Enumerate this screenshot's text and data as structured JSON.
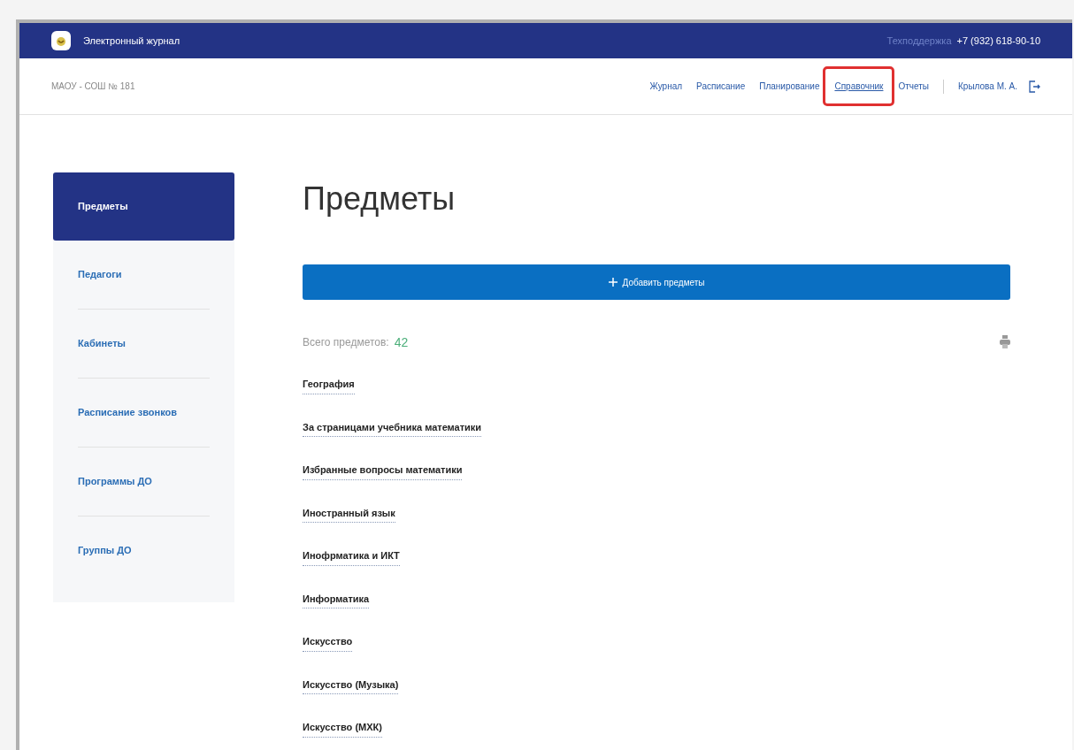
{
  "header": {
    "app_title": "Электронный журнал",
    "support_label": "Техподдержка",
    "support_phone": "+7 (932) 618-90-10"
  },
  "navbar": {
    "school": "МАОУ - СОШ № 181",
    "items": [
      {
        "label": "Журнал",
        "selected": false,
        "highlighted": false
      },
      {
        "label": "Расписание",
        "selected": false,
        "highlighted": false
      },
      {
        "label": "Планирование",
        "selected": false,
        "highlighted": false
      },
      {
        "label": "Справочник",
        "selected": true,
        "highlighted": true
      },
      {
        "label": "Отчеты",
        "selected": false,
        "highlighted": false
      }
    ],
    "user": "Крылова М. А."
  },
  "sidebar": {
    "items": [
      {
        "label": "Предметы",
        "selected": true
      },
      {
        "label": "Педагоги",
        "selected": false
      },
      {
        "label": "Кабинеты",
        "selected": false
      },
      {
        "label": "Расписание звонков",
        "selected": false
      },
      {
        "label": "Программы ДО",
        "selected": false
      },
      {
        "label": "Группы ДО",
        "selected": false
      }
    ]
  },
  "page": {
    "title": "Предметы",
    "add_button": "Добавить предметы",
    "total_label": "Всего предметов:",
    "total_value": "42",
    "subjects": [
      "География",
      "За страницами учебника математики",
      "Избранные вопросы математики",
      "Иностранный язык",
      "Инофрматика и ИКТ",
      "Информатика",
      "Искусство",
      "Искусство (Музыка)",
      "Искусство (МХК)"
    ]
  }
}
